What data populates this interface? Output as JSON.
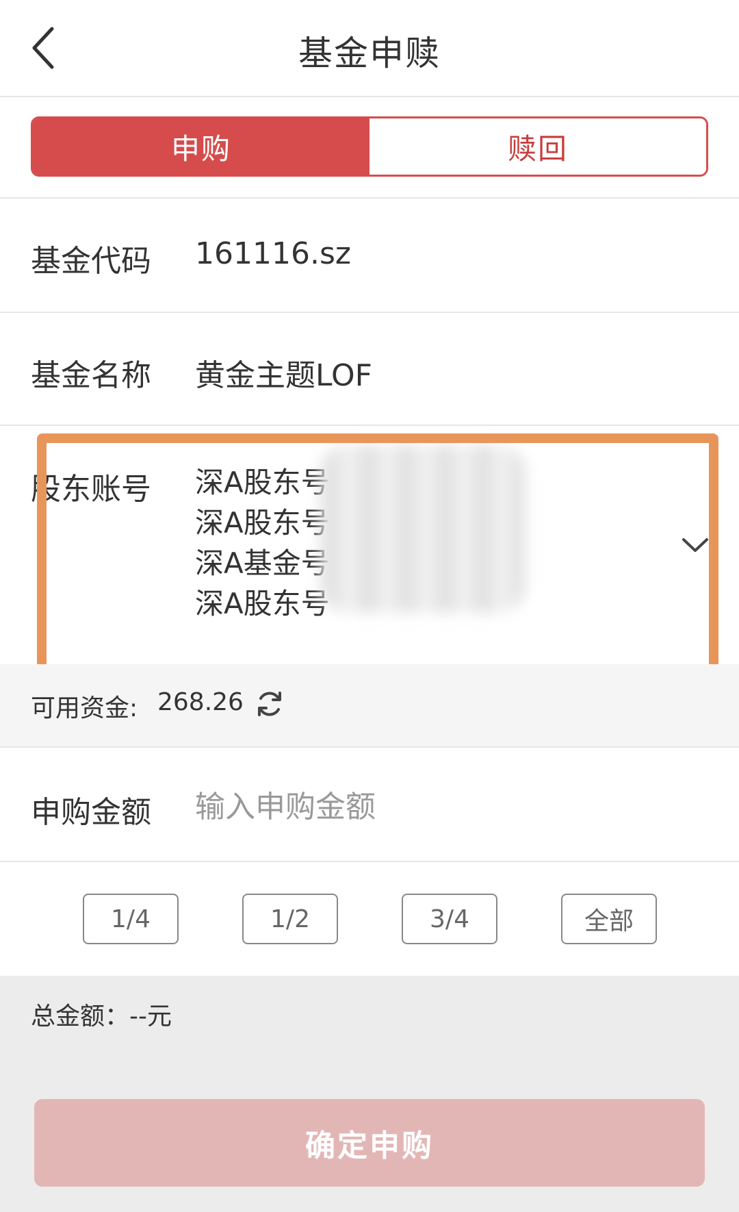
{
  "header": {
    "title": "基金申赎",
    "back_icon": "chevron-left-icon"
  },
  "tabs": [
    {
      "label": "申购",
      "active": true
    },
    {
      "label": "赎回",
      "active": false
    }
  ],
  "fund_code": {
    "label": "基金代码",
    "value": "161116.sz"
  },
  "fund_name": {
    "label": "基金名称",
    "value": "黄金主题LOF"
  },
  "shareholder_account": {
    "label": "股东账号",
    "options": [
      "深A股东号",
      "深A股东号",
      "深A基金号",
      "深A股东号"
    ],
    "chevron_icon": "chevron-down-icon"
  },
  "available_funds": {
    "label": "可用资金:",
    "value": "268.26",
    "refresh_icon": "refresh-icon"
  },
  "purchase_amount": {
    "label": "申购金额",
    "placeholder": "输入申购金额"
  },
  "quick_amounts": [
    "1/4",
    "1/2",
    "3/4",
    "全部"
  ],
  "total": {
    "text": "总金额：--元"
  },
  "confirm_button": {
    "label": "确定申购"
  },
  "colors": {
    "accent": "#d64c4c",
    "confirm_disabled": "#e3b6b6",
    "highlight_box": "#e8955a"
  }
}
